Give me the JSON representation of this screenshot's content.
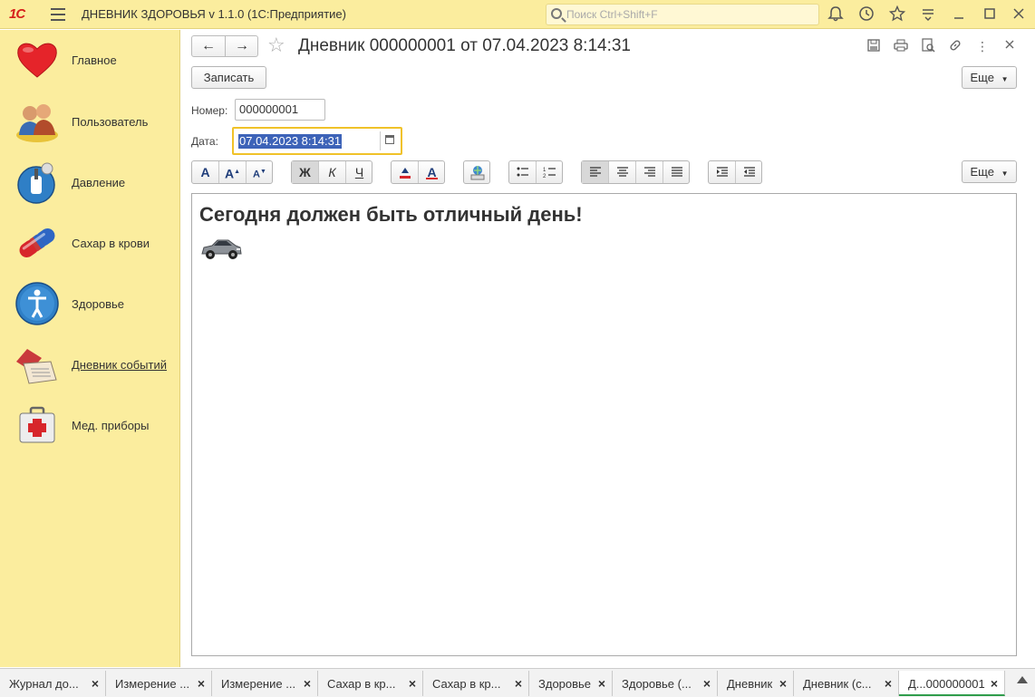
{
  "app": {
    "logo": "1С",
    "title": "ДНЕВНИК ЗДОРОВЬЯ v 1.1.0  (1С:Предприятие)",
    "search_placeholder": "Поиск Ctrl+Shift+F"
  },
  "sidebar": {
    "items": [
      {
        "label": "Главное",
        "icon": "heart-icon"
      },
      {
        "label": "Пользователь",
        "icon": "users-icon"
      },
      {
        "label": "Давление",
        "icon": "pressure-icon"
      },
      {
        "label": "Сахар в крови",
        "icon": "pill-icon"
      },
      {
        "label": "Здоровье",
        "icon": "person-icon"
      },
      {
        "label": "Дневник событий",
        "icon": "diary-icon"
      },
      {
        "label": "Мед. приборы",
        "icon": "medkit-icon"
      }
    ]
  },
  "form": {
    "title": "Дневник 000000001 от 07.04.2023 8:14:31",
    "save_label": "Записать",
    "more_label": "Еще",
    "number_label": "Номер:",
    "number_value": "000000001",
    "date_label": "Дата:",
    "date_value": "07.04.2023  8:14:31",
    "format_more_label": "Еще",
    "bold": "Ж",
    "italic": "К",
    "underline": "Ч",
    "font_a": "A",
    "content_heading": "Сегодня должен быть отличный день!"
  },
  "tabs": [
    {
      "label": "Журнал до..."
    },
    {
      "label": "Измерение ..."
    },
    {
      "label": "Измерение ..."
    },
    {
      "label": "Сахар в кр..."
    },
    {
      "label": "Сахар в кр..."
    },
    {
      "label": "Здоровье"
    },
    {
      "label": "Здоровье (..."
    },
    {
      "label": "Дневник"
    },
    {
      "label": "Дневник (с..."
    },
    {
      "label": "Д...000000001"
    }
  ],
  "colors": {
    "sidebar_bg": "#fbed9e",
    "selection": "#3d63b8",
    "focus_border": "#f0c229",
    "active_tab": "#2e9c4a"
  }
}
